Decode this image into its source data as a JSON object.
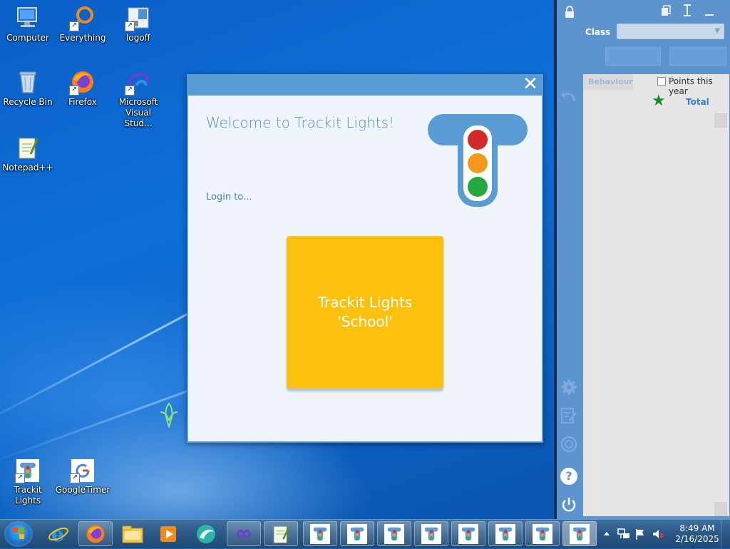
{
  "desktop": {
    "icons": [
      {
        "label": "Computer",
        "icon": "computer-icon"
      },
      {
        "label": "Everything",
        "icon": "everything-icon"
      },
      {
        "label": "logoff",
        "icon": "logoff-icon"
      },
      {
        "label": "Recycle Bin",
        "icon": "recycle-bin-icon"
      },
      {
        "label": "Firefox",
        "icon": "firefox-icon"
      },
      {
        "label": "Microsoft Visual Stud...",
        "icon": "visual-studio-icon"
      },
      {
        "label": "Notepad++",
        "icon": "notepad-plus-plus-icon"
      },
      {
        "label": "Trackit Lights",
        "icon": "trackit-lights-icon"
      },
      {
        "label": "GoogleTimer",
        "icon": "google-timer-icon"
      }
    ]
  },
  "dialog": {
    "welcome": "Welcome to Trackit Lights!",
    "login_to": "Login to...",
    "school_button_line1": "Trackit Lights",
    "school_button_line2": "'School'",
    "close_symbol": "✕"
  },
  "right_panel": {
    "class_label": "Class",
    "class_value": "",
    "tab_behaviour": "Behaviour",
    "points_this_year": "Points this year",
    "total_label": "Total",
    "help_symbol": "?"
  },
  "taskbar": {
    "pinned": [
      "internet-explorer-icon",
      "firefox-icon",
      "file-explorer-icon",
      "media-player-icon",
      "app-icon",
      "infinity-app-icon",
      "notepad-plus-plus-icon"
    ],
    "trackit_windows": 8,
    "clock_time": "8:49 AM",
    "clock_date": "2/16/2025"
  },
  "colors": {
    "dialog_frame": "#5b9bd5",
    "school_button": "#fdc00e",
    "light_red": "#d42a2a",
    "light_amber": "#f39a1d",
    "light_green": "#25a840",
    "panel_blue": "#5d93cf"
  }
}
